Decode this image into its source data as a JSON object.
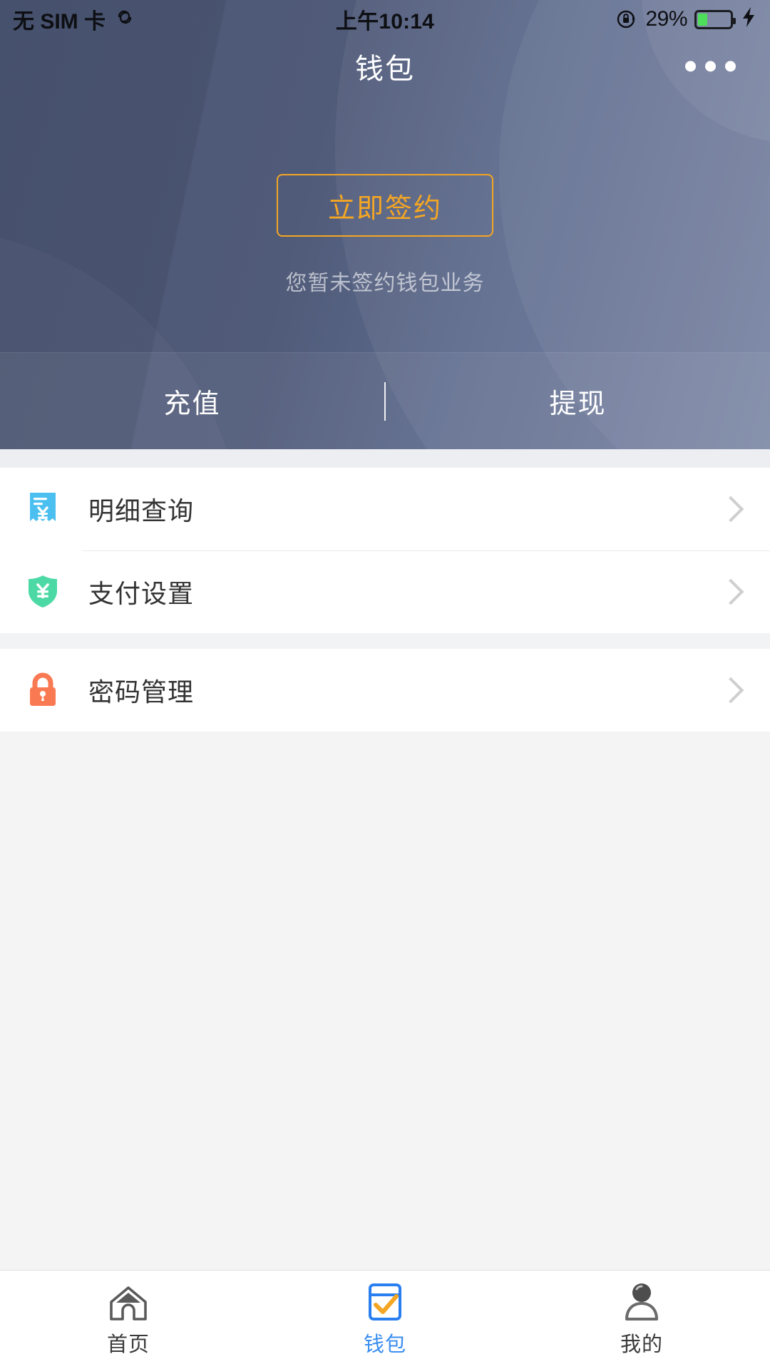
{
  "status_bar": {
    "carrier": "无 SIM 卡",
    "sync_icon": "sync-icon",
    "time": "上午10:14",
    "rotation_lock_icon": "rotation-lock-icon",
    "battery_percent": "29%",
    "battery_level": 29,
    "charging_icon": "lightning-bolt-icon"
  },
  "header": {
    "title": "钱包",
    "more_icon": "more-options-icon",
    "sign_button_label": "立即签约",
    "sign_note": "您暂未签约钱包业务",
    "accent_color": "#f5a623",
    "background_color": "#515d7b"
  },
  "action_tabs": [
    {
      "label": "充值",
      "name": "recharge"
    },
    {
      "label": "提现",
      "name": "withdraw"
    }
  ],
  "menu_groups": [
    {
      "items": [
        {
          "label": "明细查询",
          "icon": "receipt-yuan-icon",
          "icon_color": "#4bc0f0",
          "name": "transaction-details"
        },
        {
          "label": "支付设置",
          "icon": "shield-yuan-icon",
          "icon_color": "#4dd9a5",
          "name": "payment-settings"
        }
      ]
    },
    {
      "items": [
        {
          "label": "密码管理",
          "icon": "lock-icon",
          "icon_color": "#f97a52",
          "name": "password-management"
        }
      ]
    }
  ],
  "bottom_nav": {
    "active": "钱包",
    "items": [
      {
        "label": "首页",
        "icon": "home-icon",
        "active": false
      },
      {
        "label": "钱包",
        "icon": "wallet-check-icon",
        "active": true
      },
      {
        "label": "我的",
        "icon": "person-icon",
        "active": false
      }
    ]
  }
}
